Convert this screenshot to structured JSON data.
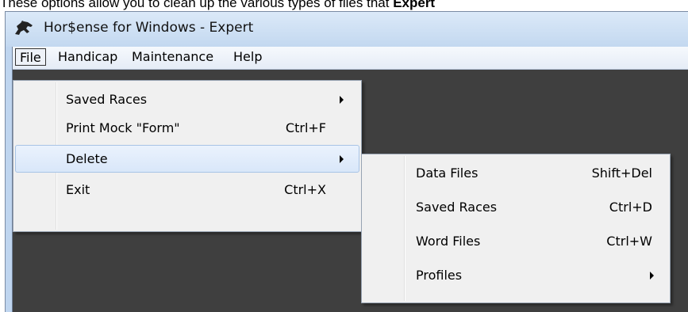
{
  "caption": {
    "text": "These options allow you to clean up the various types of files that",
    "bold": "Expert"
  },
  "window": {
    "title": "Hor$ense for Windows - Expert",
    "icon": "horse-icon"
  },
  "menubar": {
    "items": [
      {
        "label": "File"
      },
      {
        "label": "Handicap"
      },
      {
        "label": "Maintenance"
      },
      {
        "label": "Help"
      }
    ]
  },
  "file_menu": {
    "items": [
      {
        "label": "Saved Races",
        "shortcut": "",
        "submenu": true
      },
      {
        "label": "Print Mock \"Form\"",
        "shortcut": "Ctrl+F",
        "submenu": false
      },
      {
        "label": "Delete",
        "shortcut": "",
        "submenu": true,
        "highlighted": true
      },
      {
        "label": "Exit",
        "shortcut": "Ctrl+X",
        "submenu": false
      }
    ]
  },
  "delete_submenu": {
    "items": [
      {
        "label": "Data Files",
        "shortcut": "Shift+Del"
      },
      {
        "label": "Saved Races",
        "shortcut": "Ctrl+D"
      },
      {
        "label": "Word Files",
        "shortcut": "Ctrl+W"
      },
      {
        "label": "Profiles",
        "shortcut": "",
        "submenu": true
      }
    ]
  },
  "colors": {
    "titlebar": "#c9dcf2",
    "client_background": "#3f3f3f",
    "menu_background": "#f0f0f0",
    "highlight": "#d9e7f9"
  }
}
